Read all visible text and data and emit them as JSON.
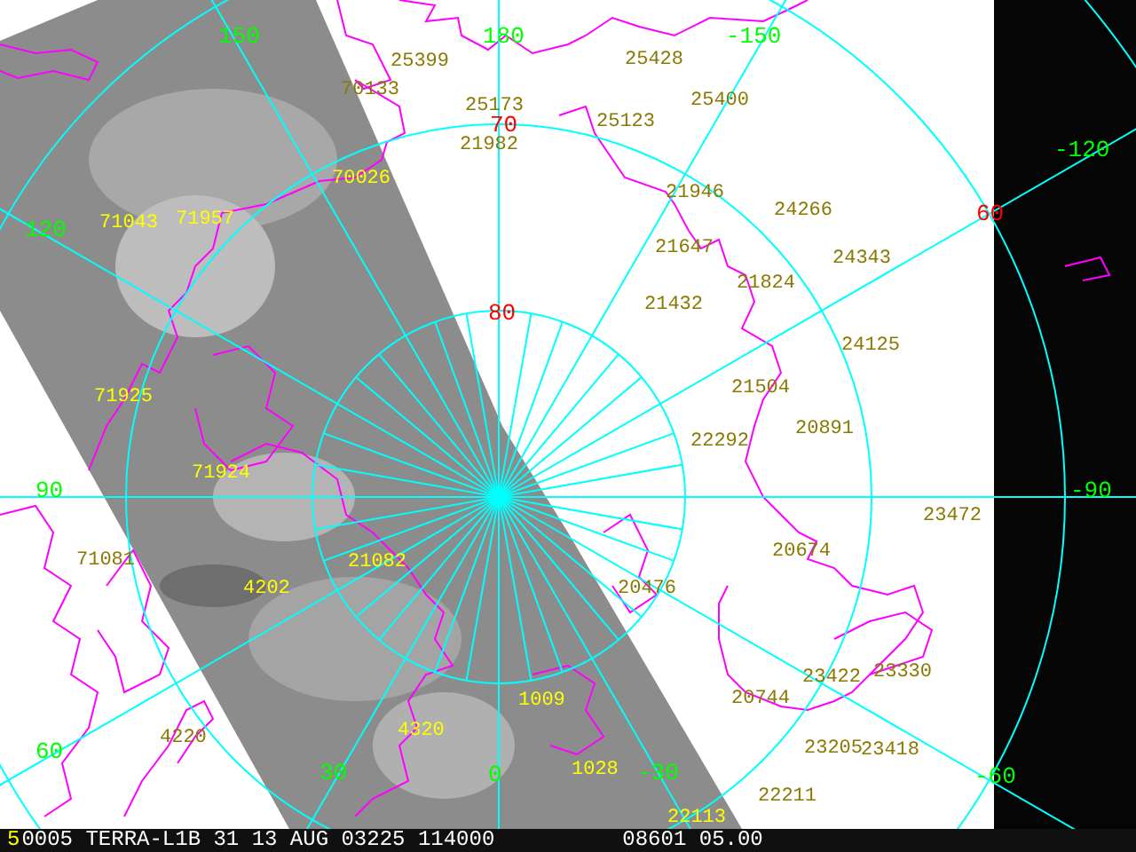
{
  "map": {
    "latitude_labels": [
      "70",
      "80",
      "60"
    ],
    "longitude_labels": [
      "150",
      "180",
      "-150",
      "-120",
      "120",
      "90",
      "-90",
      "60",
      "30",
      "0",
      "-30",
      "-60"
    ],
    "station_labels": [
      "25399",
      "70133",
      "25173",
      "21982",
      "70026",
      "71043",
      "71957",
      "71925",
      "25428",
      "25400",
      "25123",
      "21946",
      "24266",
      "21647",
      "24343",
      "21824",
      "21432",
      "24125",
      "21504",
      "20891",
      "71924",
      "71081",
      "21082",
      "4202",
      "4220",
      "4320",
      "1009",
      "22292",
      "23472",
      "20674",
      "20476",
      "23330",
      "23422",
      "20744",
      "23205",
      "23418",
      "22211",
      "1028",
      "22113"
    ]
  },
  "status_bar": {
    "frame": "5",
    "info": "0005 TERRA-L1B 31 13 AUG 03225 114000",
    "time": "08601 05.00"
  }
}
